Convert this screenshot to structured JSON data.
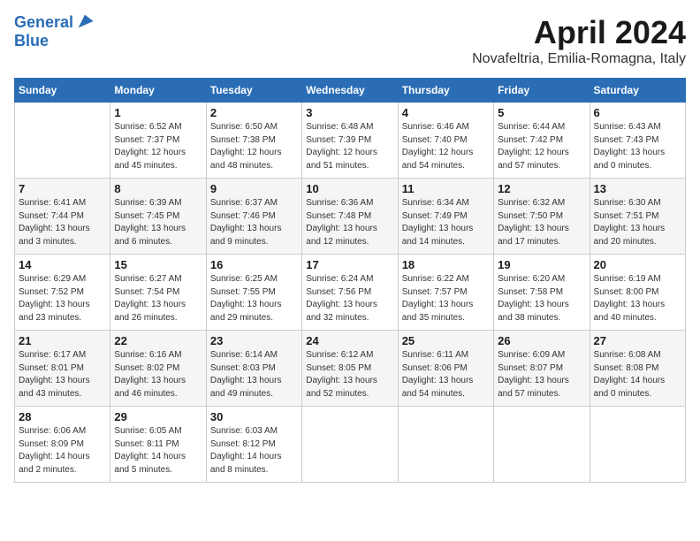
{
  "header": {
    "logo_line1": "General",
    "logo_line2": "Blue",
    "title": "April 2024",
    "subtitle": "Novafeltria, Emilia-Romagna, Italy"
  },
  "columns": [
    "Sunday",
    "Monday",
    "Tuesday",
    "Wednesday",
    "Thursday",
    "Friday",
    "Saturday"
  ],
  "weeks": [
    [
      {
        "day": "",
        "detail": ""
      },
      {
        "day": "1",
        "detail": "Sunrise: 6:52 AM\nSunset: 7:37 PM\nDaylight: 12 hours\nand 45 minutes."
      },
      {
        "day": "2",
        "detail": "Sunrise: 6:50 AM\nSunset: 7:38 PM\nDaylight: 12 hours\nand 48 minutes."
      },
      {
        "day": "3",
        "detail": "Sunrise: 6:48 AM\nSunset: 7:39 PM\nDaylight: 12 hours\nand 51 minutes."
      },
      {
        "day": "4",
        "detail": "Sunrise: 6:46 AM\nSunset: 7:40 PM\nDaylight: 12 hours\nand 54 minutes."
      },
      {
        "day": "5",
        "detail": "Sunrise: 6:44 AM\nSunset: 7:42 PM\nDaylight: 12 hours\nand 57 minutes."
      },
      {
        "day": "6",
        "detail": "Sunrise: 6:43 AM\nSunset: 7:43 PM\nDaylight: 13 hours\nand 0 minutes."
      }
    ],
    [
      {
        "day": "7",
        "detail": "Sunrise: 6:41 AM\nSunset: 7:44 PM\nDaylight: 13 hours\nand 3 minutes."
      },
      {
        "day": "8",
        "detail": "Sunrise: 6:39 AM\nSunset: 7:45 PM\nDaylight: 13 hours\nand 6 minutes."
      },
      {
        "day": "9",
        "detail": "Sunrise: 6:37 AM\nSunset: 7:46 PM\nDaylight: 13 hours\nand 9 minutes."
      },
      {
        "day": "10",
        "detail": "Sunrise: 6:36 AM\nSunset: 7:48 PM\nDaylight: 13 hours\nand 12 minutes."
      },
      {
        "day": "11",
        "detail": "Sunrise: 6:34 AM\nSunset: 7:49 PM\nDaylight: 13 hours\nand 14 minutes."
      },
      {
        "day": "12",
        "detail": "Sunrise: 6:32 AM\nSunset: 7:50 PM\nDaylight: 13 hours\nand 17 minutes."
      },
      {
        "day": "13",
        "detail": "Sunrise: 6:30 AM\nSunset: 7:51 PM\nDaylight: 13 hours\nand 20 minutes."
      }
    ],
    [
      {
        "day": "14",
        "detail": "Sunrise: 6:29 AM\nSunset: 7:52 PM\nDaylight: 13 hours\nand 23 minutes."
      },
      {
        "day": "15",
        "detail": "Sunrise: 6:27 AM\nSunset: 7:54 PM\nDaylight: 13 hours\nand 26 minutes."
      },
      {
        "day": "16",
        "detail": "Sunrise: 6:25 AM\nSunset: 7:55 PM\nDaylight: 13 hours\nand 29 minutes."
      },
      {
        "day": "17",
        "detail": "Sunrise: 6:24 AM\nSunset: 7:56 PM\nDaylight: 13 hours\nand 32 minutes."
      },
      {
        "day": "18",
        "detail": "Sunrise: 6:22 AM\nSunset: 7:57 PM\nDaylight: 13 hours\nand 35 minutes."
      },
      {
        "day": "19",
        "detail": "Sunrise: 6:20 AM\nSunset: 7:58 PM\nDaylight: 13 hours\nand 38 minutes."
      },
      {
        "day": "20",
        "detail": "Sunrise: 6:19 AM\nSunset: 8:00 PM\nDaylight: 13 hours\nand 40 minutes."
      }
    ],
    [
      {
        "day": "21",
        "detail": "Sunrise: 6:17 AM\nSunset: 8:01 PM\nDaylight: 13 hours\nand 43 minutes."
      },
      {
        "day": "22",
        "detail": "Sunrise: 6:16 AM\nSunset: 8:02 PM\nDaylight: 13 hours\nand 46 minutes."
      },
      {
        "day": "23",
        "detail": "Sunrise: 6:14 AM\nSunset: 8:03 PM\nDaylight: 13 hours\nand 49 minutes."
      },
      {
        "day": "24",
        "detail": "Sunrise: 6:12 AM\nSunset: 8:05 PM\nDaylight: 13 hours\nand 52 minutes."
      },
      {
        "day": "25",
        "detail": "Sunrise: 6:11 AM\nSunset: 8:06 PM\nDaylight: 13 hours\nand 54 minutes."
      },
      {
        "day": "26",
        "detail": "Sunrise: 6:09 AM\nSunset: 8:07 PM\nDaylight: 13 hours\nand 57 minutes."
      },
      {
        "day": "27",
        "detail": "Sunrise: 6:08 AM\nSunset: 8:08 PM\nDaylight: 14 hours\nand 0 minutes."
      }
    ],
    [
      {
        "day": "28",
        "detail": "Sunrise: 6:06 AM\nSunset: 8:09 PM\nDaylight: 14 hours\nand 2 minutes."
      },
      {
        "day": "29",
        "detail": "Sunrise: 6:05 AM\nSunset: 8:11 PM\nDaylight: 14 hours\nand 5 minutes."
      },
      {
        "day": "30",
        "detail": "Sunrise: 6:03 AM\nSunset: 8:12 PM\nDaylight: 14 hours\nand 8 minutes."
      },
      {
        "day": "",
        "detail": ""
      },
      {
        "day": "",
        "detail": ""
      },
      {
        "day": "",
        "detail": ""
      },
      {
        "day": "",
        "detail": ""
      }
    ]
  ]
}
